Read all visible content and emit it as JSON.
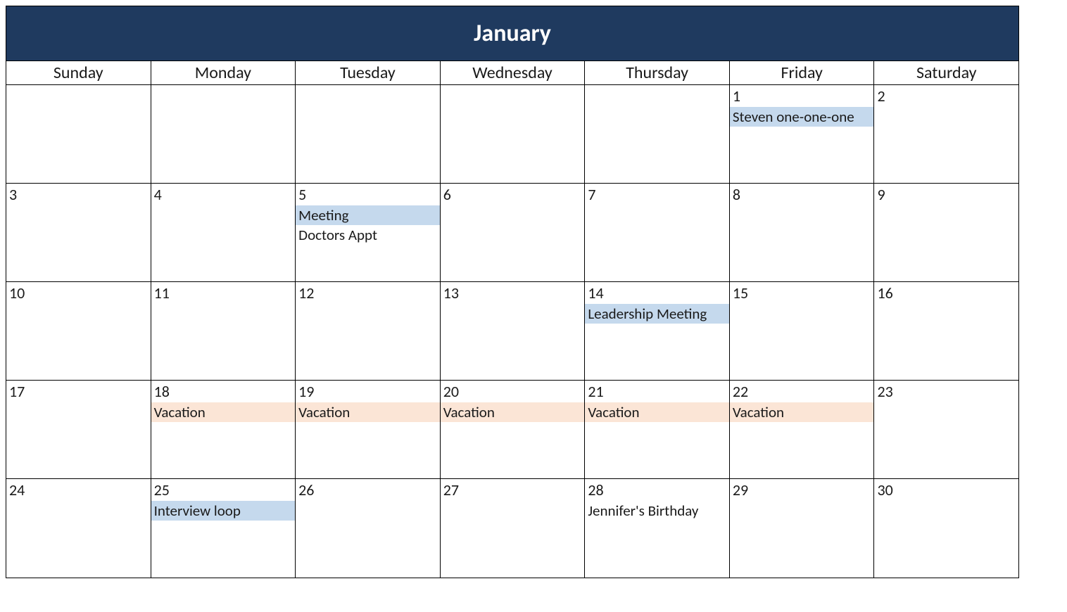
{
  "month": "January",
  "days_of_week": [
    "Sunday",
    "Monday",
    "Tuesday",
    "Wednesday",
    "Thursday",
    "Friday",
    "Saturday"
  ],
  "colors": {
    "header_bg": "#1f3a5f",
    "event_blue": "#c5d9ed",
    "event_peach": "#fbe5d6"
  },
  "weeks": [
    [
      {
        "num": "",
        "events": []
      },
      {
        "num": "",
        "events": []
      },
      {
        "num": "",
        "events": []
      },
      {
        "num": "",
        "events": []
      },
      {
        "num": "",
        "events": []
      },
      {
        "num": "1",
        "events": [
          {
            "label": "Steven one-one-one",
            "style": "blue"
          }
        ]
      },
      {
        "num": "2",
        "events": []
      }
    ],
    [
      {
        "num": "3",
        "events": []
      },
      {
        "num": "4",
        "events": []
      },
      {
        "num": "5",
        "events": [
          {
            "label": "Meeting",
            "style": "blue"
          },
          {
            "label": "Doctors Appt",
            "style": "plain"
          }
        ]
      },
      {
        "num": "6",
        "events": []
      },
      {
        "num": "7",
        "events": []
      },
      {
        "num": "8",
        "events": []
      },
      {
        "num": "9",
        "events": []
      }
    ],
    [
      {
        "num": "10",
        "events": []
      },
      {
        "num": "11",
        "events": []
      },
      {
        "num": "12",
        "events": []
      },
      {
        "num": "13",
        "events": []
      },
      {
        "num": "14",
        "events": [
          {
            "label": "Leadership Meeting",
            "style": "blue"
          }
        ]
      },
      {
        "num": "15",
        "events": []
      },
      {
        "num": "16",
        "events": []
      }
    ],
    [
      {
        "num": "17",
        "events": []
      },
      {
        "num": "18",
        "events": [
          {
            "label": "Vacation",
            "style": "peach"
          }
        ]
      },
      {
        "num": "19",
        "events": [
          {
            "label": "Vacation",
            "style": "peach"
          }
        ]
      },
      {
        "num": "20",
        "events": [
          {
            "label": "Vacation",
            "style": "peach"
          }
        ]
      },
      {
        "num": "21",
        "events": [
          {
            "label": "Vacation",
            "style": "peach"
          }
        ]
      },
      {
        "num": "22",
        "events": [
          {
            "label": "Vacation",
            "style": "peach"
          }
        ]
      },
      {
        "num": "23",
        "events": []
      }
    ],
    [
      {
        "num": "24",
        "events": []
      },
      {
        "num": "25",
        "events": [
          {
            "label": "Interview loop",
            "style": "blue"
          }
        ]
      },
      {
        "num": "26",
        "events": []
      },
      {
        "num": "27",
        "events": []
      },
      {
        "num": "28",
        "events": [
          {
            "label": "Jennifer's Birthday",
            "style": "plain"
          }
        ]
      },
      {
        "num": "29",
        "events": []
      },
      {
        "num": "30",
        "events": []
      }
    ]
  ]
}
